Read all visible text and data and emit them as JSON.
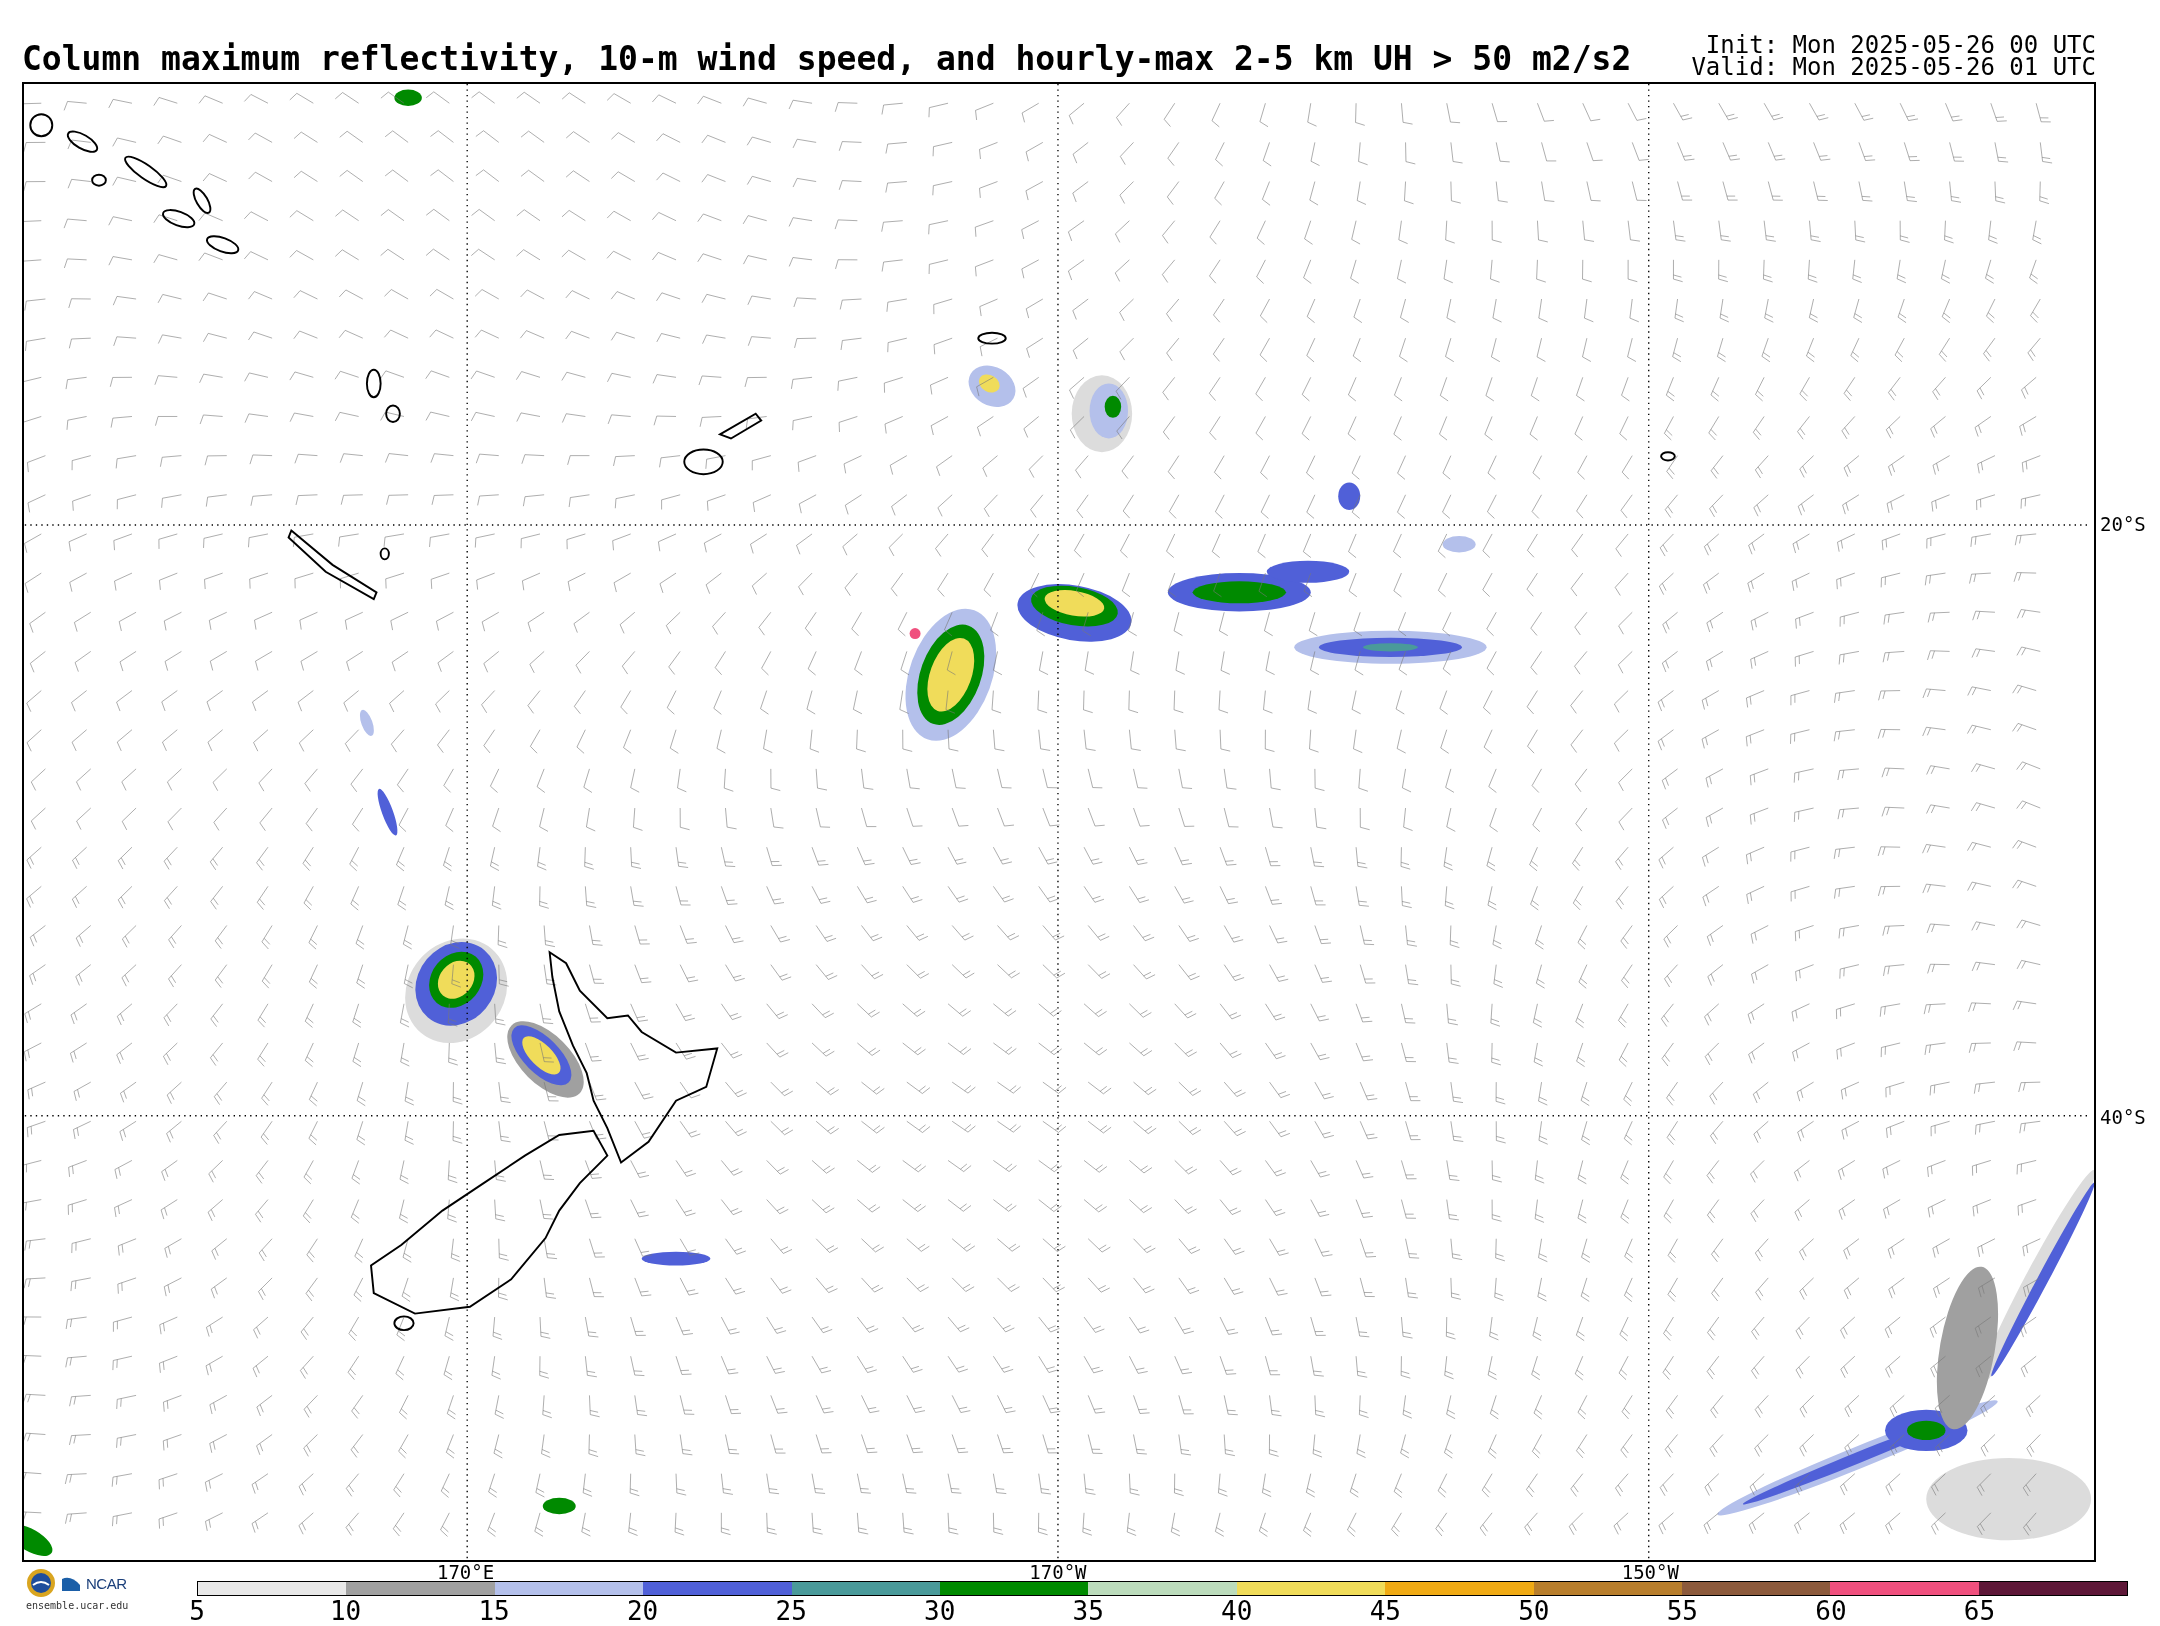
{
  "title": "Column maximum reflectivity, 10-m wind speed, and hourly-max 2-5 km UH > 50 m2/s2",
  "run_info": [
    "Init: Mon 2025-05-26 00 UTC",
    "Valid: Mon 2025-05-26 01 UTC"
  ],
  "map": {
    "latitude_labels": [
      "20°S",
      "40°S"
    ],
    "longitude_labels": [
      "170°E",
      "170°W",
      "150°W"
    ]
  },
  "credits": {
    "logo_text": "NCAR",
    "url": "ensemble.ucar.edu"
  },
  "colorbar": {
    "bins": [
      {
        "color": "#e8e8e8"
      },
      {
        "color": "#a0a0a0"
      },
      {
        "color": "#b4c0eb"
      },
      {
        "color": "#5060d8"
      },
      {
        "color": "#4a9a9a"
      },
      {
        "color": "#008a00"
      },
      {
        "color": "#bcdcbc"
      },
      {
        "color": "#f0dc5a"
      },
      {
        "color": "#f0aa14"
      },
      {
        "color": "#b87e2c"
      },
      {
        "color": "#8c5a3c"
      },
      {
        "color": "#f0507e"
      },
      {
        "color": "#5e1838"
      }
    ],
    "tick_labels": [
      "5",
      "10",
      "15",
      "20",
      "25",
      "30",
      "35",
      "40",
      "45",
      "50",
      "55",
      "60",
      "65"
    ]
  }
}
